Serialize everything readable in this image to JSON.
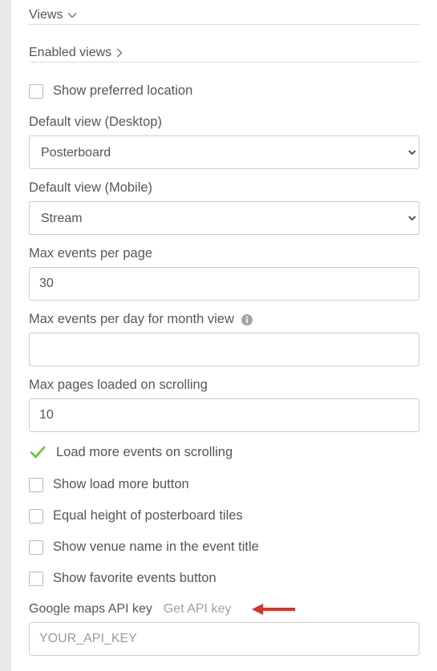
{
  "headers": {
    "views": "Views",
    "enabled_views": "Enabled views"
  },
  "checkboxes": {
    "show_preferred_location": "Show preferred location",
    "load_more_on_scroll": "Load more events on scrolling",
    "show_load_more_btn": "Show load more button",
    "equal_height_tiles": "Equal height of posterboard tiles",
    "show_venue_in_title": "Show venue name in the event title",
    "show_favorite_btn": "Show favorite events button"
  },
  "fields": {
    "default_view_desktop": {
      "label": "Default view (Desktop)",
      "value": "Posterboard"
    },
    "default_view_mobile": {
      "label": "Default view (Mobile)",
      "value": "Stream"
    },
    "max_events_page": {
      "label": "Max events per page",
      "value": "30"
    },
    "max_events_day_month": {
      "label": "Max events per day for month view",
      "value": ""
    },
    "max_pages_scroll": {
      "label": "Max pages loaded on scrolling",
      "value": "10"
    },
    "api_key": {
      "label": "Google maps API key",
      "link_text": "Get API key",
      "placeholder": "YOUR_API_KEY",
      "value": ""
    }
  },
  "colors": {
    "check_green": "#6bbf3a",
    "arrow_red": "#d4352c"
  }
}
